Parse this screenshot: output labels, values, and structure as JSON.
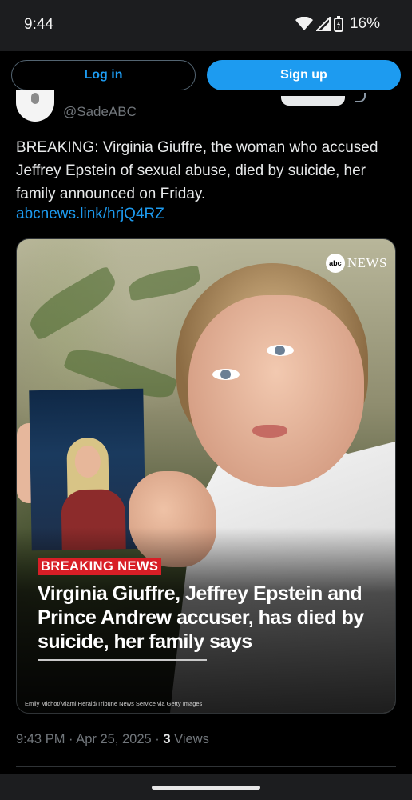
{
  "status_bar": {
    "time": "9:44",
    "battery_percent": "16%",
    "icons": [
      "wifi-icon",
      "signal-icon",
      "battery-icon"
    ]
  },
  "auth": {
    "login_label": "Log in",
    "signup_label": "Sign up"
  },
  "tweet": {
    "handle": "@SadeABC",
    "text": "BREAKING: Virginia Giuffre, the woman who accused Jeffrey Epstein of sexual abuse, died by suicide, her family announced on Friday.",
    "link": "abcnews.link/hrjQ4RZ",
    "timestamp": "9:43 PM · Apr 25, 2025 · ",
    "views_count": "3",
    "views_label": " Views"
  },
  "media": {
    "logo_abc": "abc",
    "logo_news": "NEWS",
    "badge": "BREAKING NEWS",
    "headline": "Virginia Giuffre, Jeffrey Epstein and Prince Andrew accuser, has died by suicide, her family says",
    "credit": "Emily Michot/Miami Herald/Tribune News Service via Getty Images"
  },
  "colors": {
    "accent": "#1d9bf0",
    "badge_red": "#d81e26",
    "muted": "#71767b"
  }
}
